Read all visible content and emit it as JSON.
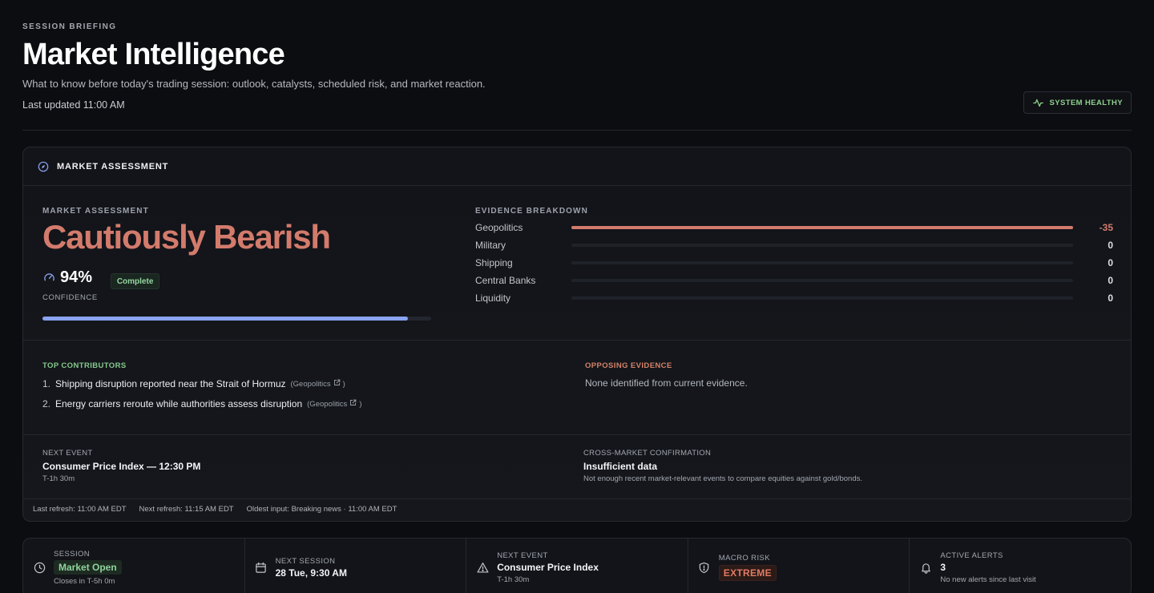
{
  "header": {
    "eyebrow": "SESSION BRIEFING",
    "title": "Market Intelligence",
    "subtitle": "What to know before today's trading session: outlook, catalysts, scheduled risk, and market reaction.",
    "last_updated": "Last updated 11:00 AM",
    "health_label": "SYSTEM HEALTHY"
  },
  "assessment_card": {
    "header_title": "MARKET ASSESSMENT",
    "label": "MARKET ASSESSMENT",
    "verdict": "Cautiously Bearish",
    "confidence_value": "94%",
    "confidence_level": 0.94,
    "confidence_label": "CONFIDENCE",
    "status_badge": "Complete",
    "evidence": {
      "title": "EVIDENCE BREAKDOWN",
      "rows": [
        {
          "name": "Geopolitics",
          "value": "-35",
          "fill": 1.0
        },
        {
          "name": "Military",
          "value": "0",
          "fill": 0
        },
        {
          "name": "Shipping",
          "value": "0",
          "fill": 0
        },
        {
          "name": "Central Banks",
          "value": "0",
          "fill": 0
        },
        {
          "name": "Liquidity",
          "value": "0",
          "fill": 0
        }
      ]
    },
    "top_contributors": {
      "title": "TOP CONTRIBUTORS",
      "items": [
        {
          "num": "1.",
          "text": "Shipping disruption reported near the Strait of Hormuz",
          "tag": "(Geopolitics"
        },
        {
          "num": "2.",
          "text": "Energy carriers reroute while authorities assess disruption",
          "tag": "(Geopolitics"
        }
      ]
    },
    "opposing": {
      "title": "OPPOSING EVIDENCE",
      "text": "None identified from current evidence."
    },
    "next_event": {
      "caption": "NEXT EVENT",
      "title": "Consumer Price Index — 12:30 PM",
      "countdown": "T-1h 30m"
    },
    "cross_market": {
      "caption": "CROSS-MARKET CONFIRMATION",
      "title": "Insufficient data",
      "detail": "Not enough recent market-relevant events to compare equities against gold/bonds."
    },
    "refresh": {
      "last": "Last refresh: 11:00 AM EDT",
      "next": "Next refresh: 11:15 AM EDT",
      "oldest": "Oldest input: Breaking news · 11:00 AM EDT"
    }
  },
  "status_bar": {
    "session": {
      "caption": "SESSION",
      "value": "Market Open",
      "sub": "Closes in T-5h 0m"
    },
    "next_session": {
      "caption": "NEXT SESSION",
      "value": "28 Tue, 9:30 AM"
    },
    "next_event": {
      "caption": "NEXT EVENT",
      "value": "Consumer Price Index",
      "sub": "T-1h 30m"
    },
    "macro_risk": {
      "caption": "MACRO RISK",
      "value": "EXTREME"
    },
    "active_alerts": {
      "caption": "ACTIVE ALERTS",
      "value": "3",
      "sub": "No new alerts since last visit"
    }
  },
  "colors": {
    "accent_bearish": "#d37b6c",
    "accent_confidence": "#8aa3f0",
    "healthy": "#8fd18f"
  }
}
